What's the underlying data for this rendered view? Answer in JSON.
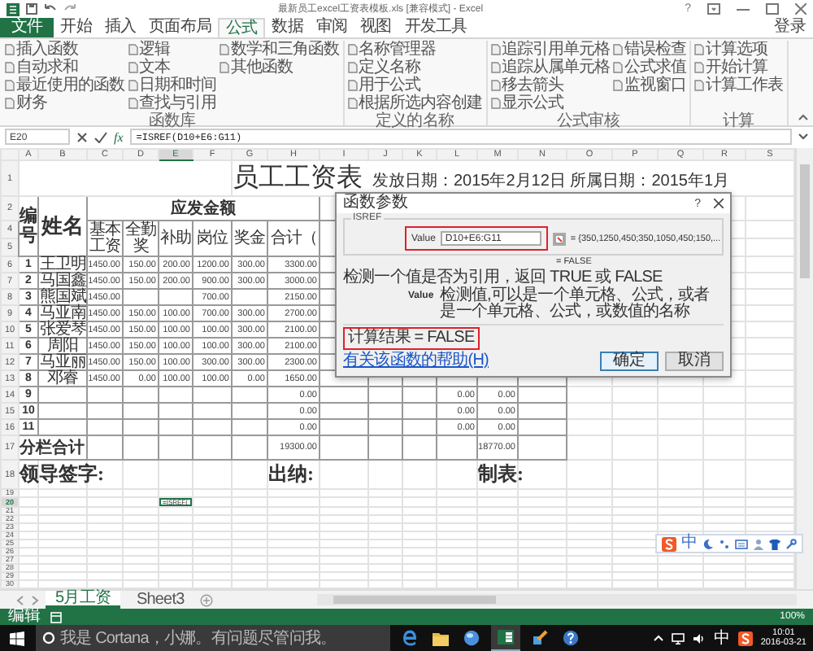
{
  "window": {
    "title": "最新员工excel工资表模板.xls [兼容模式] - Excel",
    "help": "?"
  },
  "ribbon_tabs": [
    {
      "label": "文件",
      "kind": "file",
      "selected": false
    },
    {
      "label": "开始",
      "kind": "tab",
      "selected": false
    },
    {
      "label": "插入",
      "kind": "tab",
      "selected": false
    },
    {
      "label": "页面布局",
      "kind": "tab",
      "selected": false
    },
    {
      "label": "公式",
      "kind": "tab",
      "selected": true
    },
    {
      "label": "数据",
      "kind": "tab",
      "selected": false
    },
    {
      "label": "审阅",
      "kind": "tab",
      "selected": false
    },
    {
      "label": "视图",
      "kind": "tab",
      "selected": false
    },
    {
      "label": "开发工具",
      "kind": "tab",
      "selected": false
    }
  ],
  "account": "登录",
  "ribbon_groups": [
    {
      "label": "函数库",
      "buttons": [
        "插入函数",
        "自动求和",
        "最近使用的函数",
        "财务",
        "逻辑",
        "文本",
        "日期和时间",
        "查找与引用",
        "数学和三角函数",
        "其他函数"
      ]
    },
    {
      "label": "定义的名称",
      "buttons": [
        "名称管理器",
        "定义名称",
        "用于公式",
        "根据所选内容创建"
      ]
    },
    {
      "label": "公式审核",
      "buttons": [
        "追踪引用单元格",
        "追踪从属单元格",
        "移去箭头",
        "显示公式",
        "错误检查",
        "公式求值",
        "监视窗口"
      ]
    },
    {
      "label": "计算",
      "buttons": [
        "计算选项",
        "开始计算",
        "计算工作表"
      ]
    }
  ],
  "formula_bar": {
    "name_box": "E20",
    "fx": "fx",
    "formula": "=ISREF(D10+E6:G11)"
  },
  "sheet": {
    "columns": [
      {
        "label": "A",
        "selected": false
      },
      {
        "label": "B",
        "selected": false
      },
      {
        "label": "C",
        "selected": false
      },
      {
        "label": "D",
        "selected": false
      },
      {
        "label": "E",
        "selected": true
      },
      {
        "label": "F",
        "selected": false
      },
      {
        "label": "G",
        "selected": false
      },
      {
        "label": "H",
        "selected": false
      },
      {
        "label": "I",
        "selected": false
      },
      {
        "label": "J",
        "selected": false
      },
      {
        "label": "K",
        "selected": false
      },
      {
        "label": "L",
        "selected": false
      },
      {
        "label": "M",
        "selected": false
      },
      {
        "label": "N",
        "selected": false
      },
      {
        "label": "O",
        "selected": false
      },
      {
        "label": "P",
        "selected": false
      },
      {
        "label": "Q",
        "selected": false
      },
      {
        "label": "R",
        "selected": false
      },
      {
        "label": "S",
        "selected": false
      }
    ],
    "title_row": {
      "number": "1",
      "title": "员工工资表",
      "info": "发放日期：2015年2月12日 所属日期：2015年1月"
    },
    "header": {
      "numbers": [
        "2",
        "4",
        "5"
      ],
      "id_label": "编号",
      "name_label": "姓名",
      "group_label": "应发金额",
      "labels": [
        "基本工资",
        "全勤奖",
        "补助",
        "岗位",
        "奖金",
        "合计（"
      ]
    },
    "rows": [
      {
        "number": "6",
        "kind": "data",
        "selected": false,
        "cells": {
          "A": "1",
          "B": "王卫明",
          "C": "1450.00",
          "D": "150.00",
          "E": "200.00",
          "F": "1200.00",
          "G": "300.00",
          "H": "3300.00"
        }
      },
      {
        "number": "7",
        "kind": "data",
        "selected": false,
        "cells": {
          "A": "2",
          "B": "马国鑫",
          "C": "1450.00",
          "D": "150.00",
          "E": "200.00",
          "F": "900.00",
          "G": "300.00",
          "H": "3000.00"
        }
      },
      {
        "number": "8",
        "kind": "data",
        "selected": false,
        "cells": {
          "A": "3",
          "B": "熊国斌",
          "C": "1450.00",
          "F": "700.00",
          "H": "2150.00"
        }
      },
      {
        "number": "9",
        "kind": "data",
        "selected": false,
        "cells": {
          "A": "4",
          "B": "马亚南",
          "C": "1450.00",
          "D": "150.00",
          "E": "100.00",
          "F": "700.00",
          "G": "300.00",
          "H": "2700.00"
        }
      },
      {
        "number": "10",
        "kind": "data",
        "selected": false,
        "cells": {
          "A": "5",
          "B": "张爱琴",
          "C": "1450.00",
          "D": "150.00",
          "E": "100.00",
          "F": "100.00",
          "G": "300.00",
          "H": "2100.00"
        }
      },
      {
        "number": "11",
        "kind": "data",
        "selected": false,
        "cells": {
          "A": "6",
          "B": "周阳",
          "C": "1450.00",
          "D": "150.00",
          "E": "100.00",
          "F": "100.00",
          "G": "300.00",
          "H": "2100.00"
        }
      },
      {
        "number": "12",
        "kind": "data",
        "selected": false,
        "cells": {
          "A": "7",
          "B": "马亚丽",
          "C": "1450.00",
          "D": "150.00",
          "E": "100.00",
          "F": "300.00",
          "G": "300.00",
          "H": "2300.00"
        }
      },
      {
        "number": "13",
        "kind": "data",
        "selected": false,
        "cells": {
          "A": "8",
          "B": "邓睿",
          "C": "1450.00",
          "D": "0.00",
          "E": "100.00",
          "F": "100.00",
          "G": "0.00",
          "H": "1650.00"
        }
      },
      {
        "number": "14",
        "kind": "data",
        "selected": false,
        "cells": {
          "A": "9",
          "H": "0.00",
          "L": "0.00",
          "M": "0.00"
        }
      },
      {
        "number": "15",
        "kind": "data",
        "selected": false,
        "cells": {
          "A": "10",
          "H": "0.00",
          "L": "0.00",
          "M": "0.00"
        }
      },
      {
        "number": "16",
        "kind": "data",
        "selected": false,
        "cells": {
          "A": "11",
          "H": "0.00",
          "L": "0.00",
          "M": "0.00"
        }
      },
      {
        "number": "17",
        "kind": "total",
        "selected": false,
        "cells": {
          "A": "分栏合计",
          "H": "19300.00",
          "M": "18770.00"
        }
      },
      {
        "number": "18",
        "kind": "signature",
        "selected": false,
        "cells": {
          "A": "领导签字:",
          "H": "出纳:",
          "M": "制表:"
        }
      },
      {
        "number": "19",
        "kind": "blank",
        "selected": false
      },
      {
        "number": "20",
        "kind": "blank",
        "selected": true,
        "cells": {
          "E": "=ISREF("
        }
      },
      {
        "number": "21",
        "kind": "blank",
        "selected": false
      },
      {
        "number": "22",
        "kind": "blank",
        "selected": false
      },
      {
        "number": "23",
        "kind": "blank",
        "selected": false
      },
      {
        "number": "24",
        "kind": "blank",
        "selected": false
      },
      {
        "number": "25",
        "kind": "blank",
        "selected": false
      },
      {
        "number": "26",
        "kind": "blank",
        "selected": false
      },
      {
        "number": "27",
        "kind": "blank",
        "selected": false
      },
      {
        "number": "28",
        "kind": "blank",
        "selected": false
      },
      {
        "number": "29",
        "kind": "blank",
        "selected": false
      },
      {
        "number": "30",
        "kind": "blank",
        "selected": false
      }
    ]
  },
  "dialog": {
    "title": "函数参数",
    "help": "?",
    "function_name": "ISREF",
    "argument_label": "Value",
    "argument_value": "D10+E6:G11",
    "argument_highlighted": true,
    "argument_preview": "= {350,1250,450;350,1050,450;150,...",
    "result_preview": "= FALSE",
    "description": "检测一个值是否为引用，返回 TRUE 或 FALSE",
    "argument_name": "Value",
    "argument_help": "检测值,可以是一个单元格、公式，或者是一个单元格、公式，或数值的名称",
    "result": "计算结果 =  FALSE",
    "result_highlighted": true,
    "help_link": "有关该函数的帮助(H)",
    "buttons": [
      {
        "label": "确定",
        "default": true
      },
      {
        "label": "取消",
        "default": false
      }
    ]
  },
  "sheet_tabs": [
    {
      "label": "5月工资",
      "selected": true
    },
    {
      "label": "Sheet3",
      "selected": false
    }
  ],
  "status_bar": {
    "mode": "编辑",
    "zoom": "100%"
  },
  "ime_toolbar": {
    "mode": "中"
  },
  "taskbar": {
    "search_placeholder": "我是 Cortana，小娜。有问题尽管问我。",
    "ime": "中",
    "time": "10:01",
    "date": "2016-03-21"
  }
}
